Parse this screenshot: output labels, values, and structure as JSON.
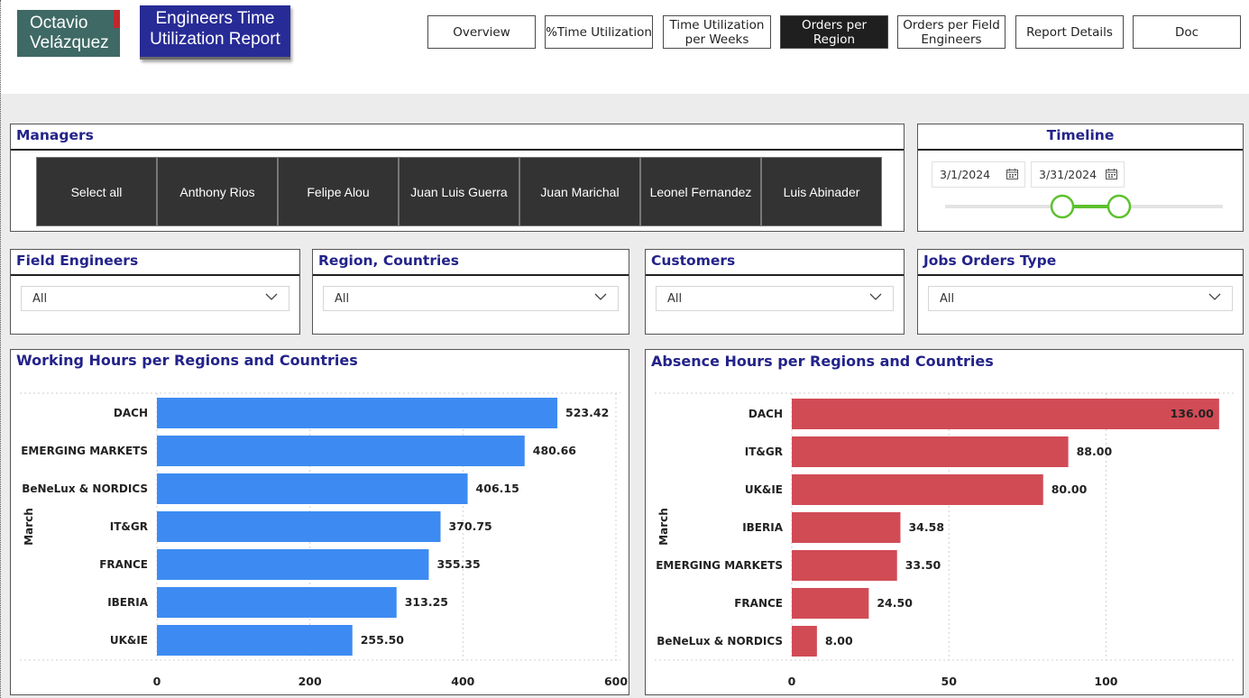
{
  "header": {
    "logo_line1": "Octavio",
    "logo_line2": "Velázquez",
    "title_line1": "Engineers Time",
    "title_line2": "Utilization Report"
  },
  "nav": [
    {
      "label": "Overview",
      "active": false
    },
    {
      "label": "%Time Utilization",
      "active": false
    },
    {
      "label": "Time Utilization per Weeks",
      "active": false
    },
    {
      "label": "Orders per Region",
      "active": true
    },
    {
      "label": "Orders per Field Engineers",
      "active": false
    },
    {
      "label": "Report Details",
      "active": false
    },
    {
      "label": "Doc",
      "active": false
    }
  ],
  "managers": {
    "title": "Managers",
    "items": [
      "Select all",
      "Anthony Rios",
      "Felipe Alou",
      "Juan Luis Guerra",
      "Juan Marichal",
      "Leonel Fernandez",
      "Luis Abinader"
    ]
  },
  "timeline": {
    "title": "Timeline",
    "start_date": "3/1/2024",
    "end_date": "3/31/2024",
    "accent": "#5cc12e"
  },
  "filters": {
    "field_engineers": {
      "title": "Field Engineers",
      "value": "All"
    },
    "region": {
      "title": "Region, Countries",
      "value": "All"
    },
    "customers": {
      "title": "Customers",
      "value": "All"
    },
    "jobs": {
      "title": "Jobs Orders Type",
      "value": "All"
    }
  },
  "chart_data": [
    {
      "type": "bar",
      "orientation": "horizontal",
      "title": "Working Hours per Regions and Countries",
      "ylabel": "March",
      "categories": [
        "DACH",
        "EMERGING MARKETS",
        "BeNeLux & NORDICS",
        "IT&GR",
        "FRANCE",
        "IBERIA",
        "UK&IE"
      ],
      "values": [
        523.42,
        480.66,
        406.15,
        370.75,
        355.35,
        313.25,
        255.5
      ],
      "labels": [
        "523.42",
        "480.66",
        "406.15",
        "370.75",
        "355.35",
        "313.25",
        "255.50"
      ],
      "xlim": [
        0,
        600
      ],
      "xticks": [
        0,
        200,
        400,
        600
      ],
      "color": "#3d8bf2",
      "grid": true
    },
    {
      "type": "bar",
      "orientation": "horizontal",
      "title": "Absence Hours per Regions and Countries",
      "ylabel": "March",
      "categories": [
        "DACH",
        "IT&GR",
        "UK&IE",
        "IBERIA",
        "EMERGING MARKETS",
        "FRANCE",
        "BeNeLux & NORDICS"
      ],
      "values": [
        136.0,
        88.0,
        80.0,
        34.58,
        33.5,
        24.5,
        8.0
      ],
      "labels": [
        "136.00",
        "88.00",
        "80.00",
        "34.58",
        "33.50",
        "24.50",
        "8.00"
      ],
      "xlim": [
        0,
        136.9
      ],
      "xticks": [
        0,
        50,
        100
      ],
      "color": "#d14b55",
      "grid": true
    }
  ]
}
